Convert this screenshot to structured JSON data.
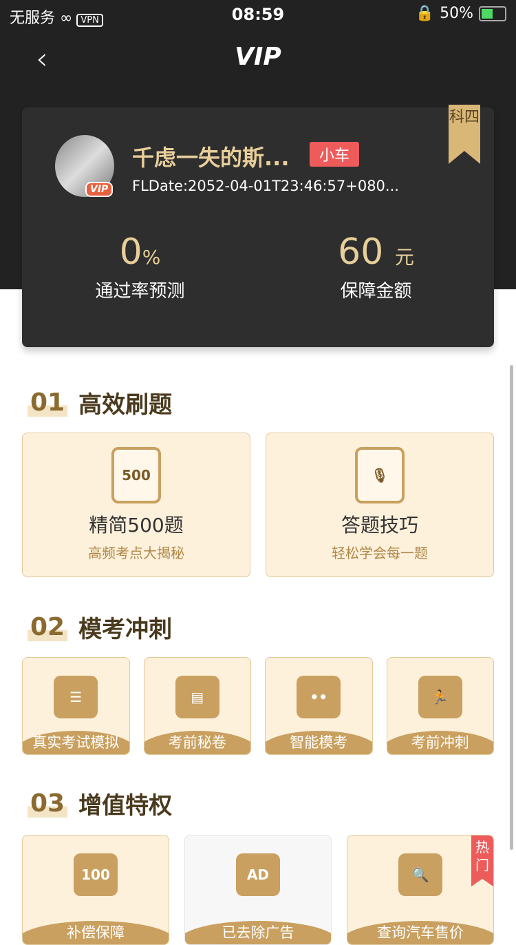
{
  "status": {
    "carrier": "无服务",
    "vpn": "VPN",
    "time": "08:59",
    "battery": "50%"
  },
  "nav": {
    "title": "VIP"
  },
  "profile": {
    "name": "千虑一失的斯...",
    "vip_badge": "VIP",
    "car_tag": "小车",
    "date": "FLDate:2052-04-01T23:46:57+080...",
    "subject": "科四",
    "pass_rate": "0",
    "pass_rate_unit": "%",
    "pass_rate_label": "通过率预测",
    "amount": "60",
    "amount_unit": "元",
    "amount_label": "保障金额"
  },
  "sections": [
    {
      "num": "01",
      "title": "高效刷题",
      "items": [
        {
          "icon": "book-500-icon",
          "glyph": "500",
          "label": "精简500题",
          "sub": "高频考点大揭秘"
        },
        {
          "icon": "microphone-icon",
          "glyph": "🎙",
          "label": "答题技巧",
          "sub": "轻松学会每一题"
        }
      ]
    },
    {
      "num": "02",
      "title": "模考冲刺",
      "items": [
        {
          "icon": "checklist-icon",
          "glyph": "☰",
          "label": "真实考试模拟"
        },
        {
          "icon": "clipboard-icon",
          "glyph": "▤",
          "label": "考前秘卷"
        },
        {
          "icon": "robot-icon",
          "glyph": "••",
          "label": "智能模考"
        },
        {
          "icon": "runner-icon",
          "glyph": "🏃",
          "label": "考前冲刺"
        }
      ]
    },
    {
      "num": "03",
      "title": "增值特权",
      "items": [
        {
          "icon": "ticket-100-icon",
          "glyph": "100",
          "label": "补偿保障"
        },
        {
          "icon": "no-ad-icon",
          "glyph": "AD",
          "label": "已去除广告"
        },
        {
          "icon": "car-search-icon",
          "glyph": "🔍",
          "label": "查询汽车售价",
          "badge": "热门"
        }
      ]
    }
  ]
}
